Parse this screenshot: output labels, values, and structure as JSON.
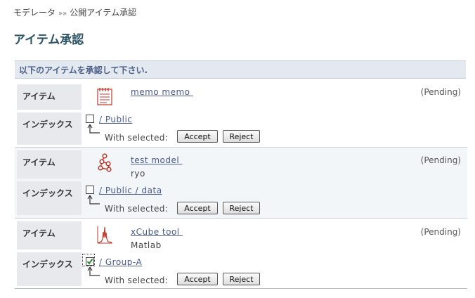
{
  "breadcrumb": {
    "parent": "モデレータ",
    "separator": "»»",
    "current": "公開アイテム承認"
  },
  "page_title": "アイテム承認",
  "notice": "以下のアイテムを承認して下さい.",
  "labels": {
    "item": "アイテム",
    "index": "インデックス"
  },
  "with_selected": "With selected:",
  "buttons": {
    "accept": "Accept",
    "reject": "Reject"
  },
  "colors": {
    "accent_title": "#2d5566",
    "link": "#4a5a8a",
    "notice_bg": "#e4e9f0",
    "icon_red": "#c0392b"
  },
  "items": [
    {
      "icon": "memo-icon",
      "name": "memo memo ",
      "owner": "",
      "status": "(Pending)",
      "index": "/ Public",
      "checked": false
    },
    {
      "icon": "model-icon",
      "name": "test model ",
      "owner": "ryo",
      "status": "(Pending)",
      "index": "/ Public / data",
      "checked": false
    },
    {
      "icon": "tool-icon",
      "name": "xCube tool ",
      "owner": "Matlab",
      "status": "(Pending)",
      "index": "/ Group-A",
      "checked": true
    }
  ]
}
